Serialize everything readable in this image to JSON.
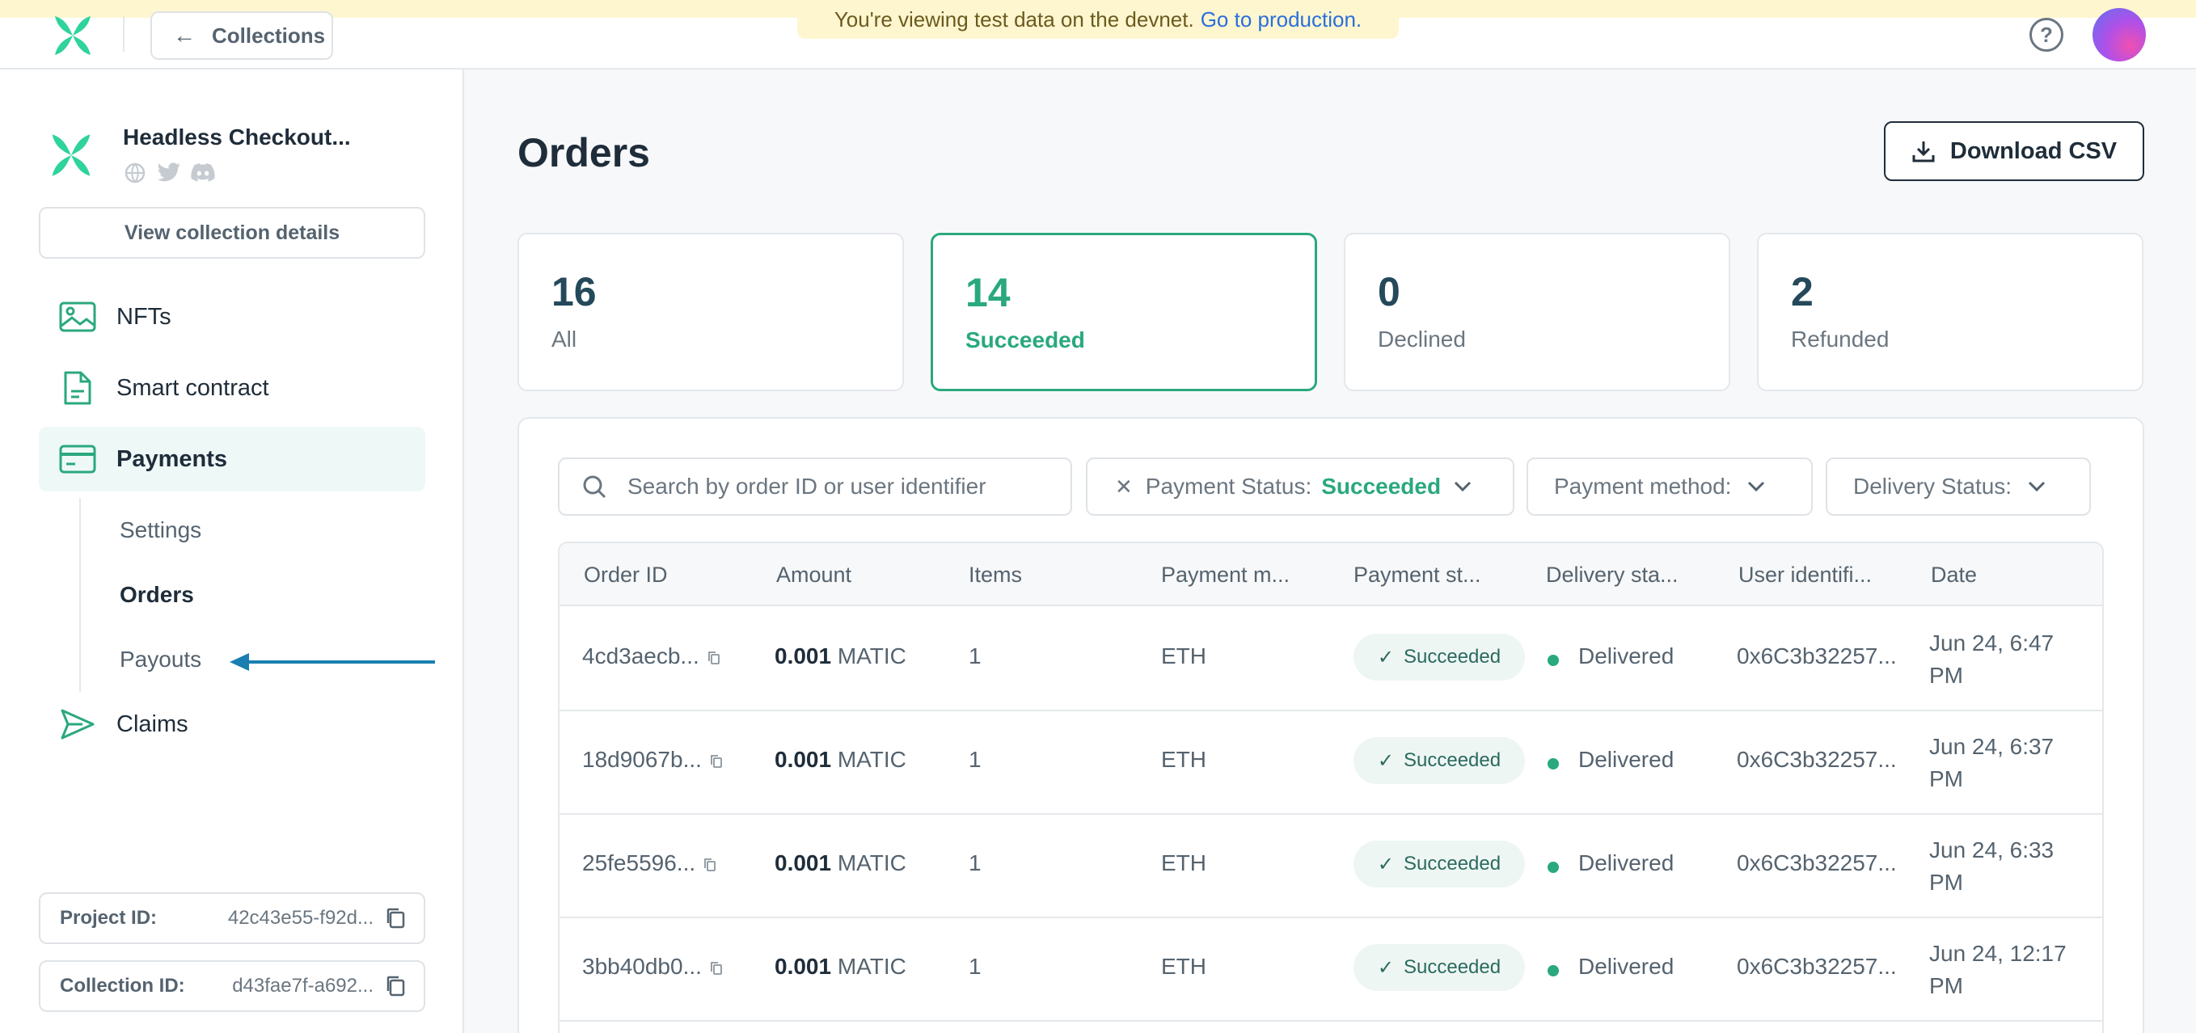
{
  "banner": {
    "text": "You're viewing test data on the devnet.",
    "link": "Go to production."
  },
  "topbar": {
    "back_label": "Collections",
    "help": "?"
  },
  "project": {
    "name": "Headless Checkout...",
    "view_details": "View collection details"
  },
  "nav": {
    "nfts": "NFTs",
    "smart_contract": "Smart contract",
    "payments": "Payments",
    "sub": {
      "settings": "Settings",
      "orders": "Orders",
      "payouts": "Payouts"
    },
    "claims": "Claims"
  },
  "ids": {
    "project_label": "Project ID:",
    "project_value": "42c43e55-f92d...",
    "collection_label": "Collection ID:",
    "collection_value": "d43fae7f-a692..."
  },
  "page": {
    "title": "Orders",
    "download": "Download CSV"
  },
  "stats": [
    {
      "num": "16",
      "label": "All"
    },
    {
      "num": "14",
      "label": "Succeeded"
    },
    {
      "num": "0",
      "label": "Declined"
    },
    {
      "num": "2",
      "label": "Refunded"
    }
  ],
  "filters": {
    "search_placeholder": "Search by order ID or user identifier",
    "payment_status_label": "Payment Status:",
    "payment_status_value": "Succeeded",
    "payment_method_label": "Payment method:",
    "delivery_status_label": "Delivery Status:"
  },
  "table": {
    "headers": [
      "Order ID",
      "Amount",
      "Items",
      "Payment m...",
      "Payment st...",
      "Delivery sta...",
      "User identifi...",
      "Date"
    ],
    "rows": [
      {
        "id": "4cd3aecb...",
        "amount": "0.001",
        "currency": "MATIC",
        "items": "1",
        "method": "ETH",
        "status": "Succeeded",
        "delivery": "Delivered",
        "user": "0x6C3b32257...",
        "date1": "Jun 24, 6:47",
        "date2": "PM"
      },
      {
        "id": "18d9067b...",
        "amount": "0.001",
        "currency": "MATIC",
        "items": "1",
        "method": "ETH",
        "status": "Succeeded",
        "delivery": "Delivered",
        "user": "0x6C3b32257...",
        "date1": "Jun 24, 6:37",
        "date2": "PM"
      },
      {
        "id": "25fe5596...",
        "amount": "0.001",
        "currency": "MATIC",
        "items": "1",
        "method": "ETH",
        "status": "Succeeded",
        "delivery": "Delivered",
        "user": "0x6C3b32257...",
        "date1": "Jun 24, 6:33",
        "date2": "PM"
      },
      {
        "id": "3bb40db0...",
        "amount": "0.001",
        "currency": "MATIC",
        "items": "1",
        "method": "ETH",
        "status": "Succeeded",
        "delivery": "Delivered",
        "user": "0x6C3b32257...",
        "date1": "Jun 24, 12:17",
        "date2": "PM"
      }
    ]
  },
  "colors": {
    "accent": "#2aa87e",
    "annotation_arrow": "#1a7fb0",
    "banner_bg": "#fdf6cf"
  }
}
